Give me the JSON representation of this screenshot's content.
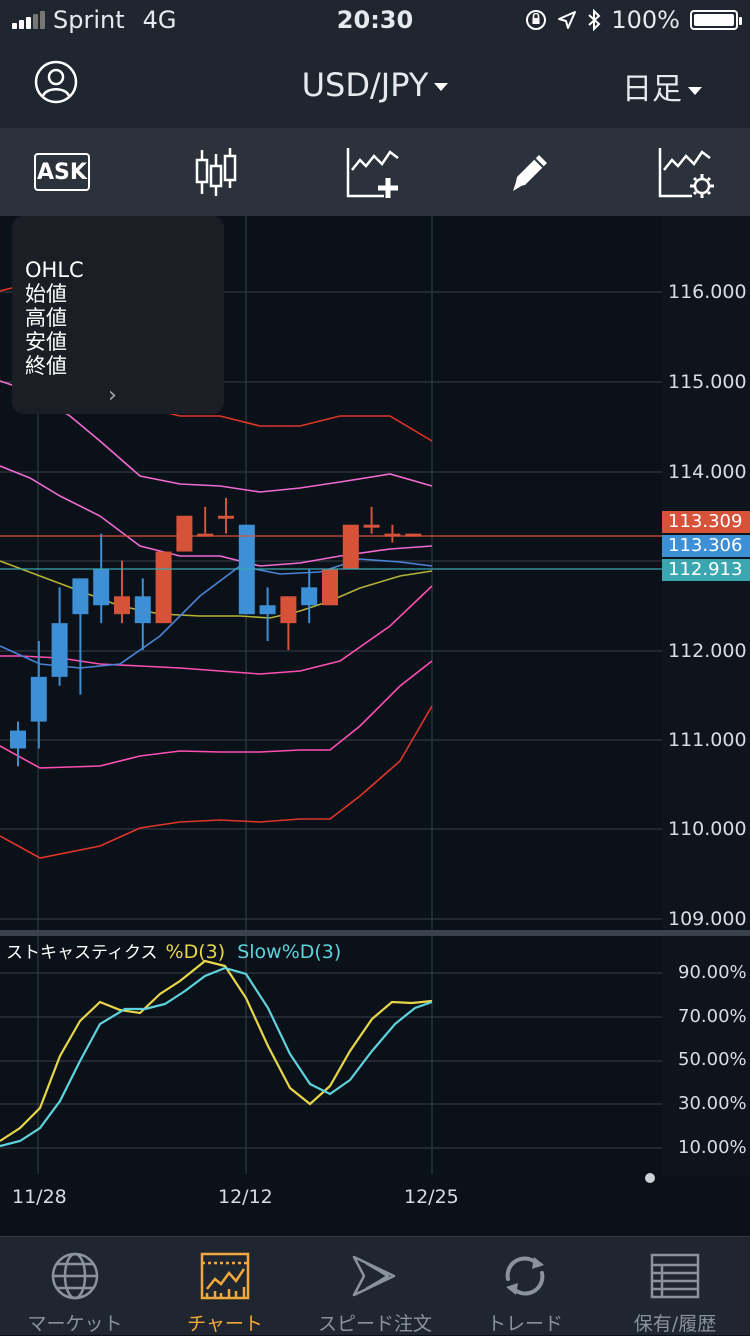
{
  "status_bar": {
    "carrier": "Sprint",
    "network": "4G",
    "time": "20:30",
    "battery": "100%",
    "icons": [
      "orientation-lock-icon",
      "location-arrow-icon",
      "bluetooth-icon",
      "battery-icon"
    ]
  },
  "header": {
    "pair": "USD/JPY",
    "period": "日足",
    "icons": [
      "profile-icon",
      "dropdown-caret-icon"
    ]
  },
  "toolbar": {
    "ask_label": "ASK",
    "icons": [
      "ask-icon",
      "candlestick-type-icon",
      "add-indicator-icon",
      "drawing-pen-icon",
      "chart-settings-icon"
    ]
  },
  "ohlc_panel": {
    "title": "OHLC",
    "open": "始値",
    "high": "高値",
    "low": "安値",
    "close": "終値",
    "icon": "chevron-right-icon"
  },
  "price_axis": {
    "labels": [
      "116.000",
      "115.000",
      "114.000",
      "112.000",
      "111.000",
      "110.000",
      "109.000"
    ],
    "tags": [
      {
        "value": "113.309",
        "color": "#d6533a"
      },
      {
        "value": "113.306",
        "color": "#3d8fd6"
      },
      {
        "value": "112.913",
        "color": "#3aa7b0"
      }
    ]
  },
  "stochastic": {
    "title": "ストキャスティクス",
    "d_label": "%D(3)",
    "slowd_label": "Slow%D(3)",
    "d_color": "#e8d64a",
    "slowd_color": "#5fd3dd",
    "axis_labels": [
      "90.00%",
      "70.00%",
      "50.00%",
      "30.00%",
      "10.00%"
    ]
  },
  "date_axis": {
    "labels": [
      "11/28",
      "12/12",
      "12/25"
    ]
  },
  "tabs": [
    {
      "label": "マーケット",
      "icon": "globe-icon"
    },
    {
      "label": "チャート",
      "icon": "chart-icon",
      "active": true
    },
    {
      "label": "スピード注文",
      "icon": "speed-order-icon"
    },
    {
      "label": "トレード",
      "icon": "trade-refresh-icon"
    },
    {
      "label": "保有/履歴",
      "icon": "history-list-icon"
    }
  ],
  "colors": {
    "bull": "#d6533a",
    "bear": "#3d8fd6",
    "accent": "#f2a93b"
  },
  "chart_data": {
    "type": "candlestick",
    "price_axis_range": [
      109.0,
      116.4
    ],
    "candles": [
      {
        "o": 111.1,
        "h": 111.2,
        "l": 110.7,
        "c": 110.9
      },
      {
        "o": 111.7,
        "h": 112.1,
        "l": 110.9,
        "c": 111.2
      },
      {
        "o": 112.3,
        "h": 112.7,
        "l": 111.6,
        "c": 111.7
      },
      {
        "o": 112.8,
        "h": 112.8,
        "l": 111.5,
        "c": 112.4
      },
      {
        "o": 112.9,
        "h": 113.3,
        "l": 112.3,
        "c": 112.5
      },
      {
        "o": 112.4,
        "h": 113.0,
        "l": 112.3,
        "c": 112.6
      },
      {
        "o": 112.6,
        "h": 112.8,
        "l": 112.0,
        "c": 112.3
      },
      {
        "o": 112.3,
        "h": 113.0,
        "l": 112.3,
        "c": 113.1
      },
      {
        "o": 113.1,
        "h": 113.5,
        "l": 113.1,
        "c": 113.5
      },
      {
        "o": 113.3,
        "h": 113.6,
        "l": 113.3,
        "c": 113.3
      },
      {
        "o": 113.5,
        "h": 113.7,
        "l": 113.3,
        "c": 113.5
      },
      {
        "o": 113.4,
        "h": 113.4,
        "l": 112.4,
        "c": 112.4
      },
      {
        "o": 112.5,
        "h": 112.7,
        "l": 112.1,
        "c": 112.4
      },
      {
        "o": 112.3,
        "h": 112.6,
        "l": 112.0,
        "c": 112.6
      },
      {
        "o": 112.7,
        "h": 112.9,
        "l": 112.3,
        "c": 112.5
      },
      {
        "o": 112.5,
        "h": 112.9,
        "l": 112.5,
        "c": 112.9
      },
      {
        "o": 112.9,
        "h": 113.3,
        "l": 112.9,
        "c": 113.4
      },
      {
        "o": 113.4,
        "h": 113.6,
        "l": 113.3,
        "c": 113.4
      },
      {
        "o": 113.3,
        "h": 113.4,
        "l": 113.2,
        "c": 113.3
      },
      {
        "o": 113.3,
        "h": 113.3,
        "l": 113.28,
        "c": 113.3
      }
    ]
  }
}
